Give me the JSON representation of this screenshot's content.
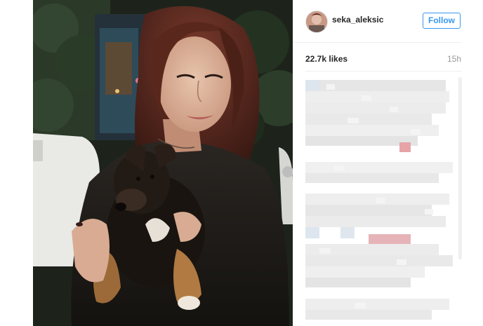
{
  "post": {
    "username": "seka_aleksic",
    "follow_label": "Follow",
    "likes": "22.7k likes",
    "time_ago": "15h"
  },
  "icons": {
    "avatar": "profile-avatar"
  },
  "colors": {
    "follow_blue": "#3897f0",
    "text_dark": "#262626",
    "text_muted": "#999999"
  }
}
